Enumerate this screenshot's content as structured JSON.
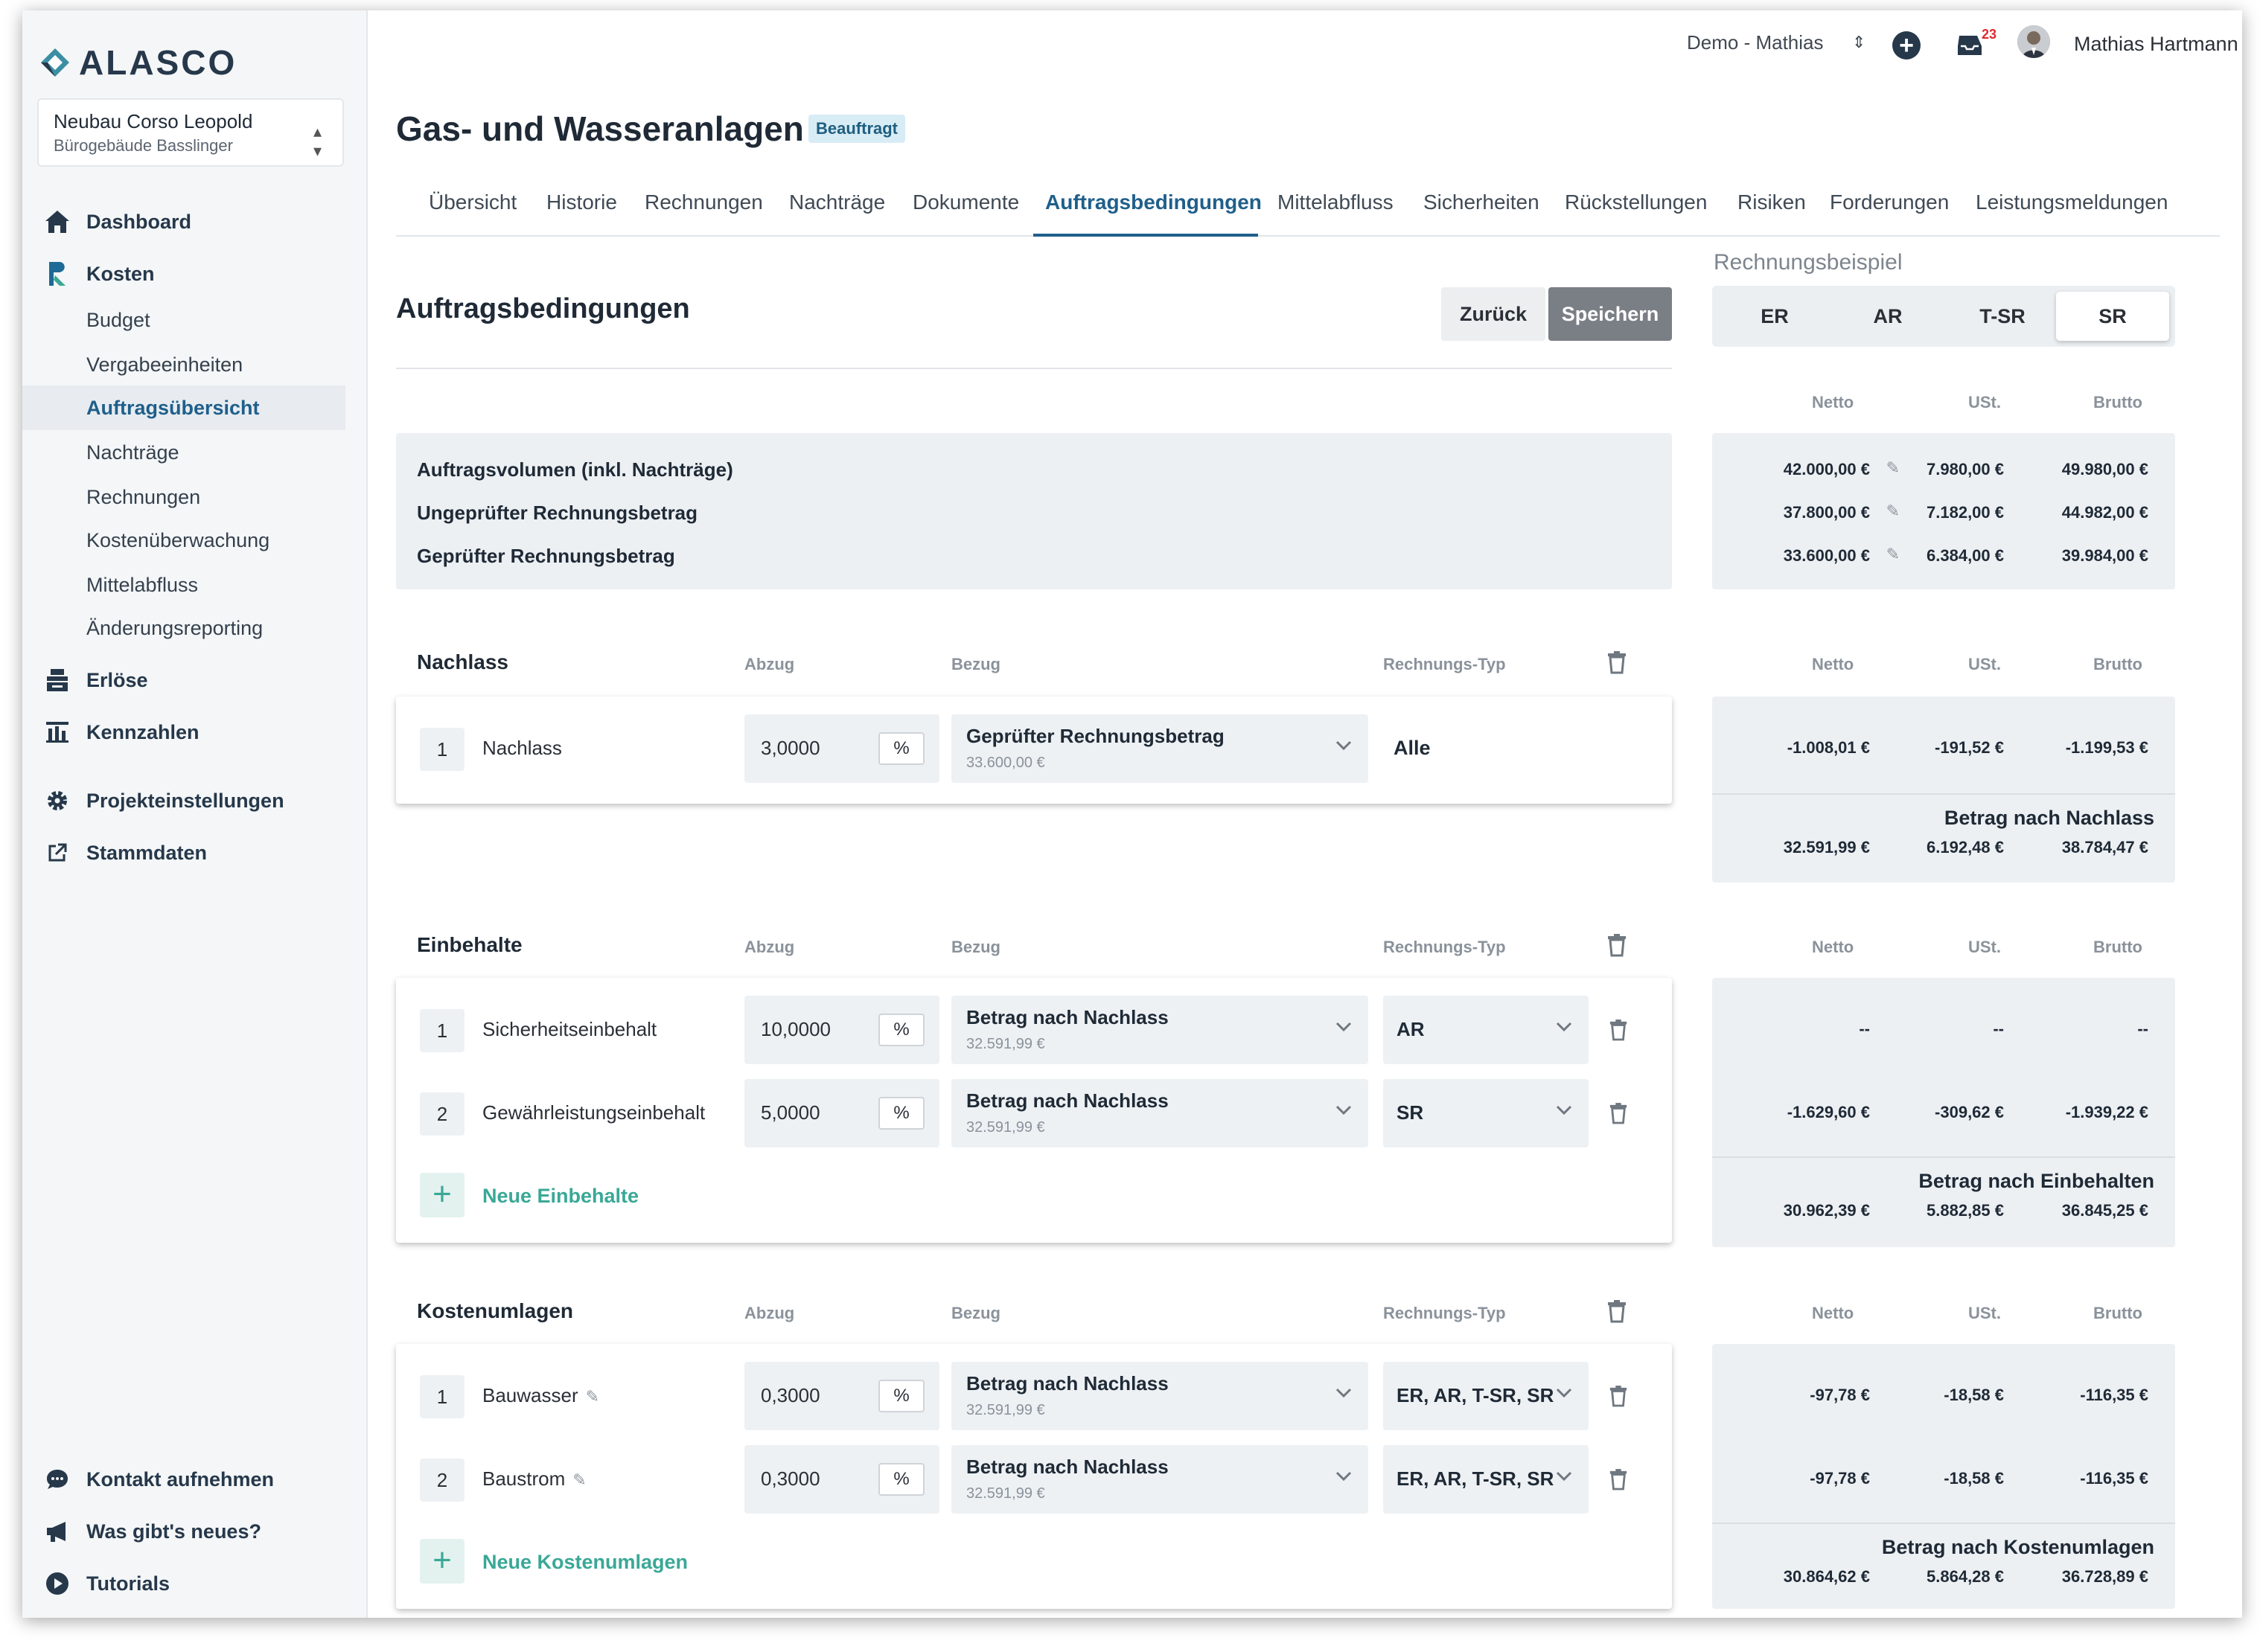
{
  "app": {
    "logo": "ALASCO"
  },
  "project": {
    "name": "Neubau Corso Leopold",
    "sub": "Bürogebäude Basslinger"
  },
  "nav": {
    "dashboard": "Dashboard",
    "kosten": "Kosten",
    "kosten_items": [
      "Budget",
      "Vergabeeinheiten",
      "Auftragsübersicht",
      "Nachträge",
      "Rechnungen",
      "Kostenüberwachung",
      "Mittelabfluss",
      "Änderungsreporting"
    ],
    "erloese": "Erlöse",
    "kennzahlen": "Kennzahlen",
    "projekteinstellungen": "Projekteinstellungen",
    "stammdaten": "Stammdaten",
    "kontakt": "Kontakt aufnehmen",
    "neues": "Was gibt's neues?",
    "tutorials": "Tutorials"
  },
  "topbar": {
    "workspace": "Demo - Mathias",
    "notifications": "23",
    "user": "Mathias Hartmann"
  },
  "page": {
    "title": "Gas- und Wasseranlagen",
    "status": "Beauftragt"
  },
  "tabs": [
    "Übersicht",
    "Historie",
    "Rechnungen",
    "Nachträge",
    "Dokumente",
    "Auftragsbedingungen",
    "Mittelabfluss",
    "Sicherheiten",
    "Rückstellungen",
    "Risiken",
    "Forderungen",
    "Leistungsmeldungen"
  ],
  "section": {
    "title": "Auftragsbedingungen",
    "back": "Zurück",
    "save": "Speichern"
  },
  "summary": [
    "Auftragsvolumen (inkl. Nachträge)",
    "Ungeprüfter Rechnungsbetrag",
    "Geprüfter Rechnungsbetrag"
  ],
  "cols": {
    "abzug": "Abzug",
    "bezug": "Bezug",
    "typ": "Rechnungs-Typ",
    "netto": "Netto",
    "ust": "USt.",
    "brutto": "Brutto"
  },
  "nachlass": {
    "title": "Nachlass",
    "rows": [
      {
        "num": "1",
        "name": "Nachlass",
        "value": "3,0000",
        "unit": "%",
        "bezug": "Geprüfter Rechnungsbetrag",
        "bezug_amount": "33.600,00 €",
        "typ": "Alle"
      }
    ]
  },
  "einbehalte": {
    "title": "Einbehalte",
    "rows": [
      {
        "num": "1",
        "name": "Sicherheitseinbehalt",
        "value": "10,0000",
        "unit": "%",
        "bezug": "Betrag nach Nachlass",
        "bezug_amount": "32.591,99 €",
        "typ": "AR"
      },
      {
        "num": "2",
        "name": "Gewährleistungseinbehalt",
        "value": "5,0000",
        "unit": "%",
        "bezug": "Betrag nach Nachlass",
        "bezug_amount": "32.591,99 €",
        "typ": "SR"
      }
    ],
    "add": "Neue Einbehalte"
  },
  "kostenumlagen": {
    "title": "Kostenumlagen",
    "rows": [
      {
        "num": "1",
        "name": "Bauwasser",
        "value": "0,3000",
        "unit": "%",
        "bezug": "Betrag nach Nachlass",
        "bezug_amount": "32.591,99 €",
        "typ": "ER, AR, T-SR, SR"
      },
      {
        "num": "2",
        "name": "Baustrom",
        "value": "0,3000",
        "unit": "%",
        "bezug": "Betrag nach Nachlass",
        "bezug_amount": "32.591,99 €",
        "typ": "ER, AR, T-SR, SR"
      }
    ],
    "add": "Neue Kostenumlagen"
  },
  "rb": {
    "label": "Rechnungsbeispiel",
    "types": [
      "ER",
      "AR",
      "T-SR",
      "SR"
    ],
    "active": "SR",
    "summary": [
      {
        "netto": "42.000,00 €",
        "ust": "7.980,00 €",
        "brutto": "49.980,00 €"
      },
      {
        "netto": "37.800,00 €",
        "ust": "7.182,00 €",
        "brutto": "44.982,00 €"
      },
      {
        "netto": "33.600,00 €",
        "ust": "6.384,00 €",
        "brutto": "39.984,00 €"
      }
    ],
    "nachlass": [
      {
        "netto": "-1.008,01 €",
        "ust": "-191,52 €",
        "brutto": "-1.199,53 €"
      }
    ],
    "nachlass_total": {
      "label": "Betrag nach Nachlass",
      "netto": "32.591,99 €",
      "ust": "6.192,48 €",
      "brutto": "38.784,47 €"
    },
    "einbehalte": [
      {
        "netto": "--",
        "ust": "--",
        "brutto": "--"
      },
      {
        "netto": "-1.629,60 €",
        "ust": "-309,62 €",
        "brutto": "-1.939,22 €"
      }
    ],
    "einbehalte_total": {
      "label": "Betrag nach Einbehalten",
      "netto": "30.962,39 €",
      "ust": "5.882,85 €",
      "brutto": "36.845,25 €"
    },
    "kostenumlagen": [
      {
        "netto": "-97,78 €",
        "ust": "-18,58 €",
        "brutto": "-116,35 €"
      },
      {
        "netto": "-97,78 €",
        "ust": "-18,58 €",
        "brutto": "-116,35 €"
      }
    ],
    "kostenumlagen_total": {
      "label": "Betrag nach Kostenumlagen",
      "netto": "30.864,62 €",
      "ust": "5.864,28 €",
      "brutto": "36.728,89 €"
    }
  }
}
